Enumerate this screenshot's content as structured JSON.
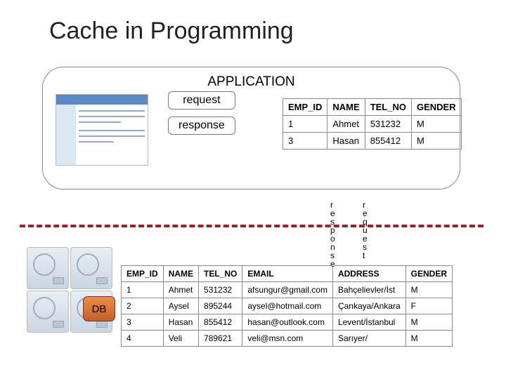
{
  "title": "Cache in Programming",
  "application_label": "APPLICATION",
  "request_label": "request",
  "response_label": "response",
  "v_response": "response",
  "v_request": "request",
  "db_label": "DB",
  "cache": {
    "headers": {
      "c0": "EMP_ID",
      "c1": "NAME",
      "c2": "TEL_NO",
      "c3": "GENDER"
    },
    "rows": [
      {
        "emp_id": "1",
        "name": "Ahmet",
        "tel": "531232",
        "g": "M"
      },
      {
        "emp_id": "3",
        "name": "Hasan",
        "tel": "855412",
        "g": "M"
      }
    ]
  },
  "db": {
    "headers": {
      "c0": "EMP_ID",
      "c1": "NAME",
      "c2": "TEL_NO",
      "c3": "EMAIL",
      "c4": "ADDRESS",
      "c5": "GENDER"
    },
    "rows": [
      {
        "emp_id": "1",
        "name": "Ahmet",
        "tel": "531232",
        "email": "afsungur@gmail.com",
        "addr": "Bahçelievler/İst",
        "g": "M"
      },
      {
        "emp_id": "2",
        "name": "Aysel",
        "tel": "895244",
        "email": "aysel@hotmail.com",
        "addr": "Çankaya/Ankara",
        "g": "F"
      },
      {
        "emp_id": "3",
        "name": "Hasan",
        "tel": "855412",
        "email": "hasan@outlook.com",
        "addr": "Levent/İstanbul",
        "g": "M"
      },
      {
        "emp_id": "4",
        "name": "Veli",
        "tel": "789621",
        "email": "veli@msn.com",
        "addr": "Sarıyer/",
        "g": "M"
      }
    ]
  }
}
